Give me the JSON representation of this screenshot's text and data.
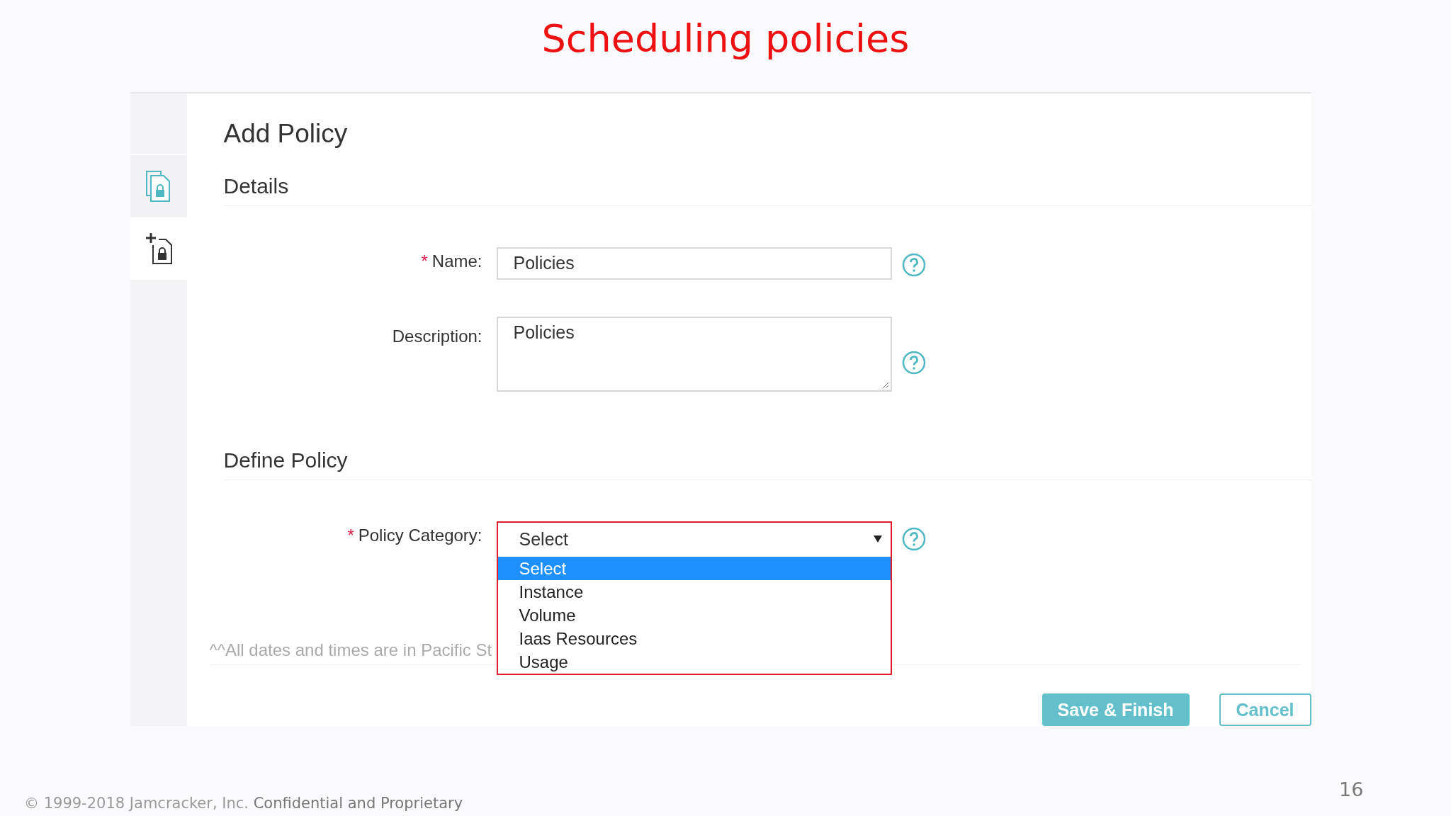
{
  "slide_title": "Scheduling policies",
  "sidebar": {
    "items": [
      {
        "kind": "policies",
        "selected": false
      },
      {
        "kind": "add-policy",
        "selected": true
      }
    ]
  },
  "form": {
    "title": "Add Policy",
    "sections": [
      {
        "heading": "Details",
        "fields": [
          {
            "kind": "text",
            "required_mark": "*",
            "label": "Name:",
            "value": "Policies"
          },
          {
            "kind": "textarea",
            "label": "Description:",
            "value": "Policies"
          }
        ]
      },
      {
        "heading": "Define Policy",
        "fields": [
          {
            "kind": "select",
            "required_mark": "*",
            "label": "Policy Category:",
            "value": "Select",
            "expanded": true,
            "options": [
              {
                "label": "Select",
                "selected": true
              },
              {
                "label": "Instance",
                "selected": false
              },
              {
                "label": "Volume",
                "selected": false
              },
              {
                "label": "Iaas Resources",
                "selected": false
              },
              {
                "label": "Usage",
                "selected": false
              }
            ]
          }
        ]
      }
    ],
    "footnote": "^^All dates and times are in Pacific St",
    "buttons": [
      {
        "kind": "primary",
        "label": "Save & Finish"
      },
      {
        "kind": "secondary",
        "label": "Cancel"
      }
    ]
  },
  "page_number": "16",
  "footer": {
    "copyright": "© 1999-2018 Jamcracker, Inc.",
    "notice": "Confidential and Proprietary"
  }
}
